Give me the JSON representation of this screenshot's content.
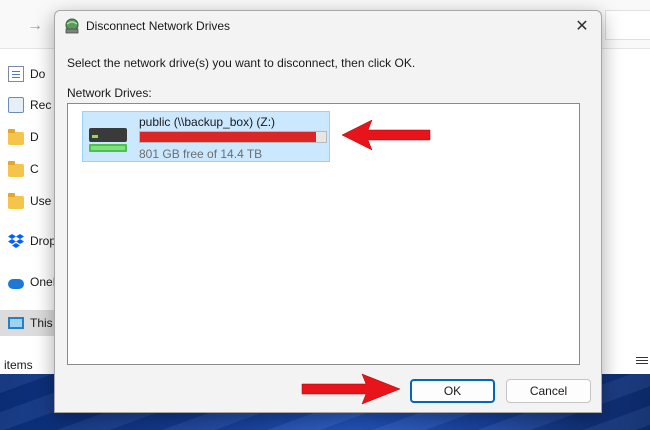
{
  "explorer": {
    "nav_items": [
      {
        "label": "Do",
        "icon": "documents-icon"
      },
      {
        "label": "Rec",
        "icon": "recent-icon"
      },
      {
        "label": "D",
        "icon": "folder-icon"
      },
      {
        "label": "C",
        "icon": "folder-icon"
      },
      {
        "label": "Use",
        "icon": "folder-icon"
      },
      {
        "label": "Drop",
        "icon": "dropbox-icon"
      },
      {
        "label": "OneI",
        "icon": "onedrive-icon"
      },
      {
        "label": "This",
        "icon": "this-pc-icon"
      }
    ],
    "status_text": "items"
  },
  "dialog": {
    "title": "Disconnect Network Drives",
    "close_glyph": "✕",
    "prompt": "Select the network drive(s) you want to disconnect, then click OK.",
    "list_label": "Network Drives:",
    "drives": [
      {
        "name": "public (\\\\backup_box) (Z:)",
        "space_text": "801 GB free of 14.4 TB",
        "used_fraction": 0.946
      }
    ],
    "ok_label": "OK",
    "cancel_label": "Cancel"
  },
  "colors": {
    "usage_bar": "#da2626",
    "selection": "#cce8ff",
    "accent": "#0067c0",
    "annotation_arrow": "#e8141b"
  }
}
